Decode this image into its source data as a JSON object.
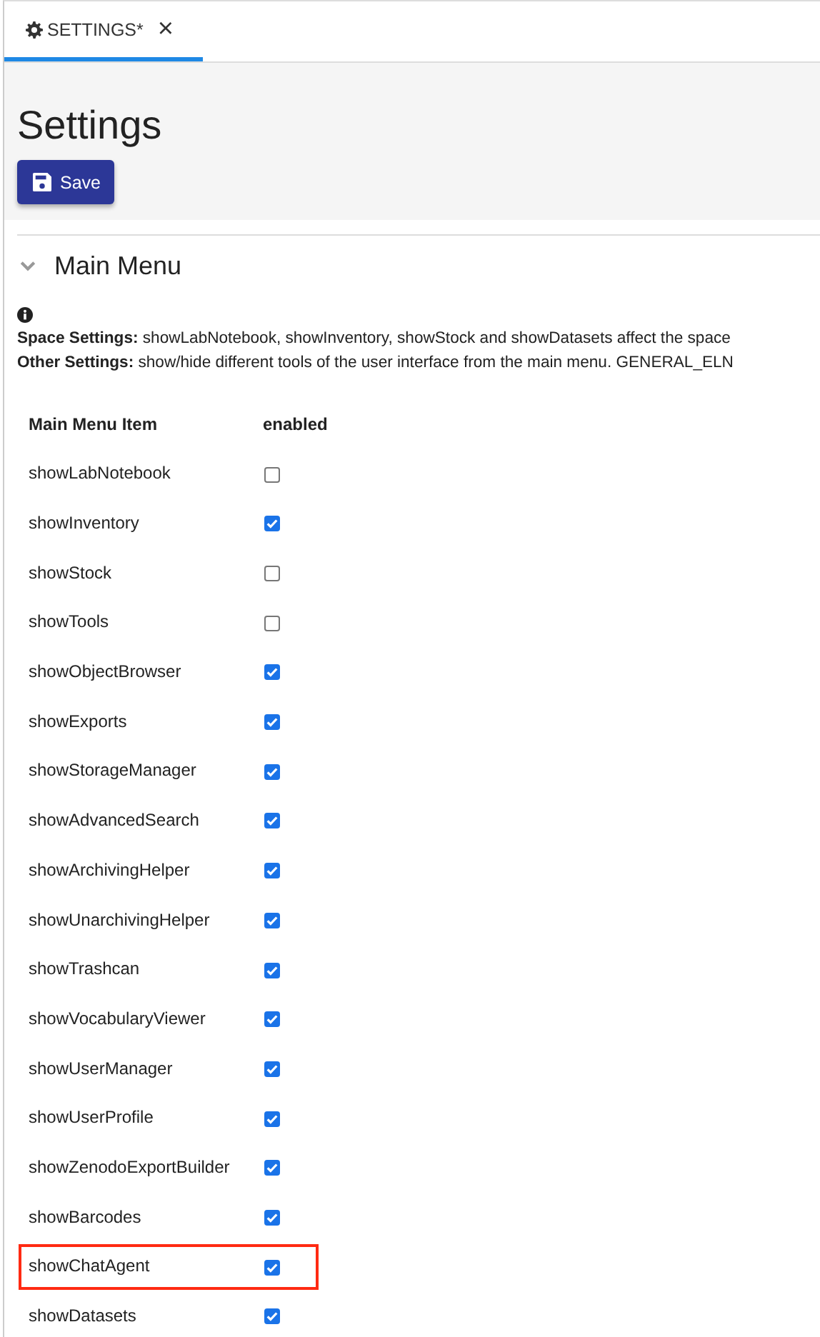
{
  "tab": {
    "label": "SETTINGS*",
    "close": "×",
    "selected": true
  },
  "page_title": "Settings",
  "save_button": "Save",
  "section": {
    "title": "Main Menu",
    "expanded": true
  },
  "info": [
    {
      "label": "Space Settings:",
      "text": "showLabNotebook, showInventory, showStock and showDatasets affect the space"
    },
    {
      "label": "Other Settings:",
      "text": "show/hide different tools of the user interface from the main menu. GENERAL_ELN"
    }
  ],
  "table": {
    "columns": [
      "Main Menu Item",
      "enabled"
    ],
    "rows": [
      {
        "name": "showLabNotebook",
        "checked": false,
        "highlighted": false
      },
      {
        "name": "showInventory",
        "checked": true,
        "highlighted": false
      },
      {
        "name": "showStock",
        "checked": false,
        "highlighted": false
      },
      {
        "name": "showTools",
        "checked": false,
        "highlighted": false
      },
      {
        "name": "showObjectBrowser",
        "checked": true,
        "highlighted": false
      },
      {
        "name": "showExports",
        "checked": true,
        "highlighted": false
      },
      {
        "name": "showStorageManager",
        "checked": true,
        "highlighted": false
      },
      {
        "name": "showAdvancedSearch",
        "checked": true,
        "highlighted": false
      },
      {
        "name": "showArchivingHelper",
        "checked": true,
        "highlighted": false
      },
      {
        "name": "showUnarchivingHelper",
        "checked": true,
        "highlighted": false
      },
      {
        "name": "showTrashcan",
        "checked": true,
        "highlighted": false
      },
      {
        "name": "showVocabularyViewer",
        "checked": true,
        "highlighted": false
      },
      {
        "name": "showUserManager",
        "checked": true,
        "highlighted": false
      },
      {
        "name": "showUserProfile",
        "checked": true,
        "highlighted": false
      },
      {
        "name": "showZenodoExportBuilder",
        "checked": true,
        "highlighted": false
      },
      {
        "name": "showBarcodes",
        "checked": true,
        "highlighted": false
      },
      {
        "name": "showChatAgent",
        "checked": true,
        "highlighted": true
      },
      {
        "name": "showDatasets",
        "checked": true,
        "highlighted": false
      }
    ]
  }
}
